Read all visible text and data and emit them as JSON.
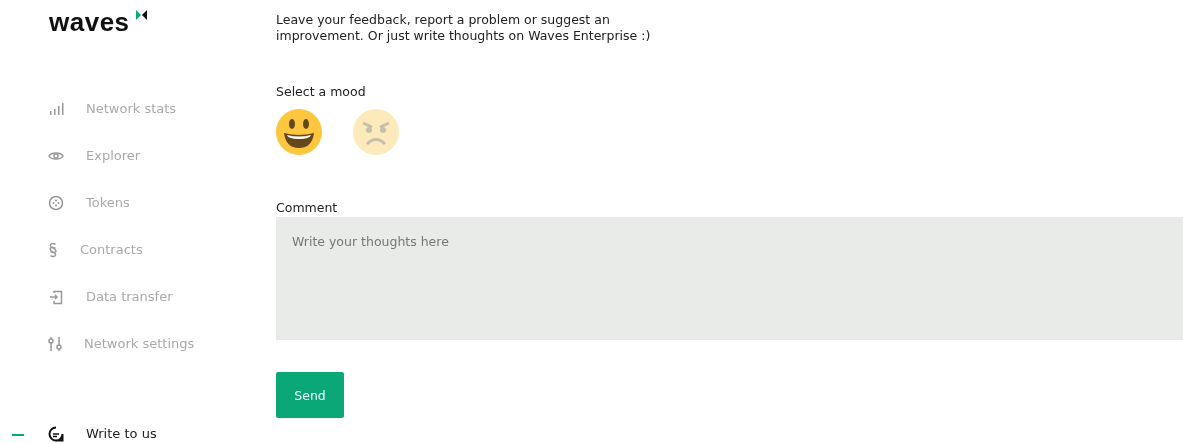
{
  "logo": {
    "text": "waves"
  },
  "nav": [
    {
      "label": "Network stats",
      "selected": false
    },
    {
      "label": "Explorer",
      "selected": false
    },
    {
      "label": "Tokens",
      "selected": false
    },
    {
      "label": "Contracts",
      "selected": false
    },
    {
      "label": "Data transfer",
      "selected": false
    },
    {
      "label": "Network settings",
      "selected": false
    }
  ],
  "footer_nav": {
    "label": "Write to us",
    "selected": true
  },
  "intro": "Leave your feedback, report a problem or suggest an improvement. Or just write thoughts on Waves Enterprise :)",
  "mood": {
    "label": "Select a mood",
    "options": [
      {
        "kind": "happy",
        "selected": true
      },
      {
        "kind": "angry",
        "selected": false
      }
    ]
  },
  "comment": {
    "label": "Comment",
    "placeholder": "Write your thoughts here"
  },
  "send_button": "Send"
}
